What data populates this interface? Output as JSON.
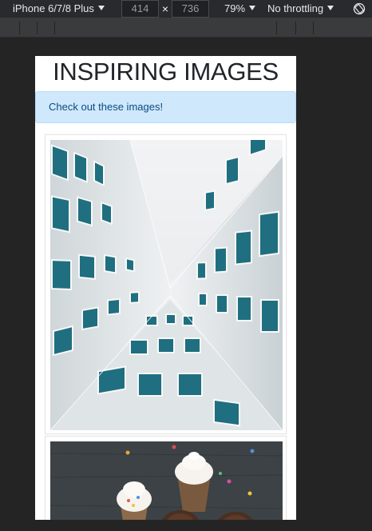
{
  "devtools": {
    "device_label": "iPhone 6/7/8 Plus",
    "width_value": "414",
    "times_symbol": "×",
    "height_value": "736",
    "zoom_label": "79%",
    "throttling_label": "No throttling",
    "icons": {
      "device_dropdown": "caret-down-icon",
      "zoom_dropdown": "caret-down-icon",
      "throttle_dropdown": "caret-down-icon",
      "rotate": "rotate-icon"
    }
  },
  "page": {
    "title": "INSPIRING IMAGES",
    "alert_text": "Check out these images!",
    "images": [
      {
        "subject": "building-looking-up"
      },
      {
        "subject": "cupcakes"
      }
    ]
  },
  "colors": {
    "toolbar_bg": "#292a2d",
    "mq_bar_bg": "#3a3b3d",
    "workspace_bg": "#242424",
    "alert_bg": "#cfe8fc",
    "alert_text": "#0c4b80",
    "facade_teal": "#1f6f80"
  }
}
